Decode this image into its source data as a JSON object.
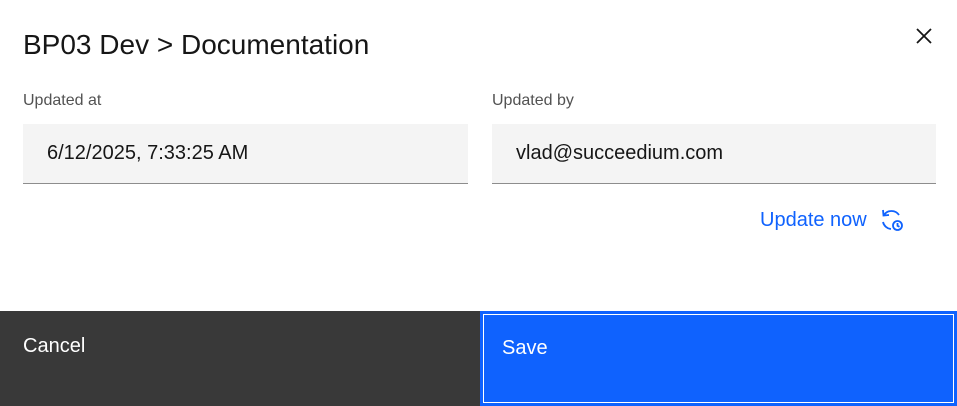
{
  "dialog": {
    "title": "BP03 Dev > Documentation",
    "close_icon": "close-icon"
  },
  "fields": {
    "updated_at": {
      "label": "Updated at",
      "value": "6/12/2025, 7:33:25 AM"
    },
    "updated_by": {
      "label": "Updated by",
      "value": "vlad@succeedium.com"
    }
  },
  "actions": {
    "update_now_label": "Update now",
    "update_now_icon": "update-now-icon"
  },
  "footer": {
    "cancel_label": "Cancel",
    "save_label": "Save"
  },
  "colors": {
    "accent": "#0f62fe",
    "secondary_button": "#393939",
    "field_background": "#f4f4f4"
  }
}
